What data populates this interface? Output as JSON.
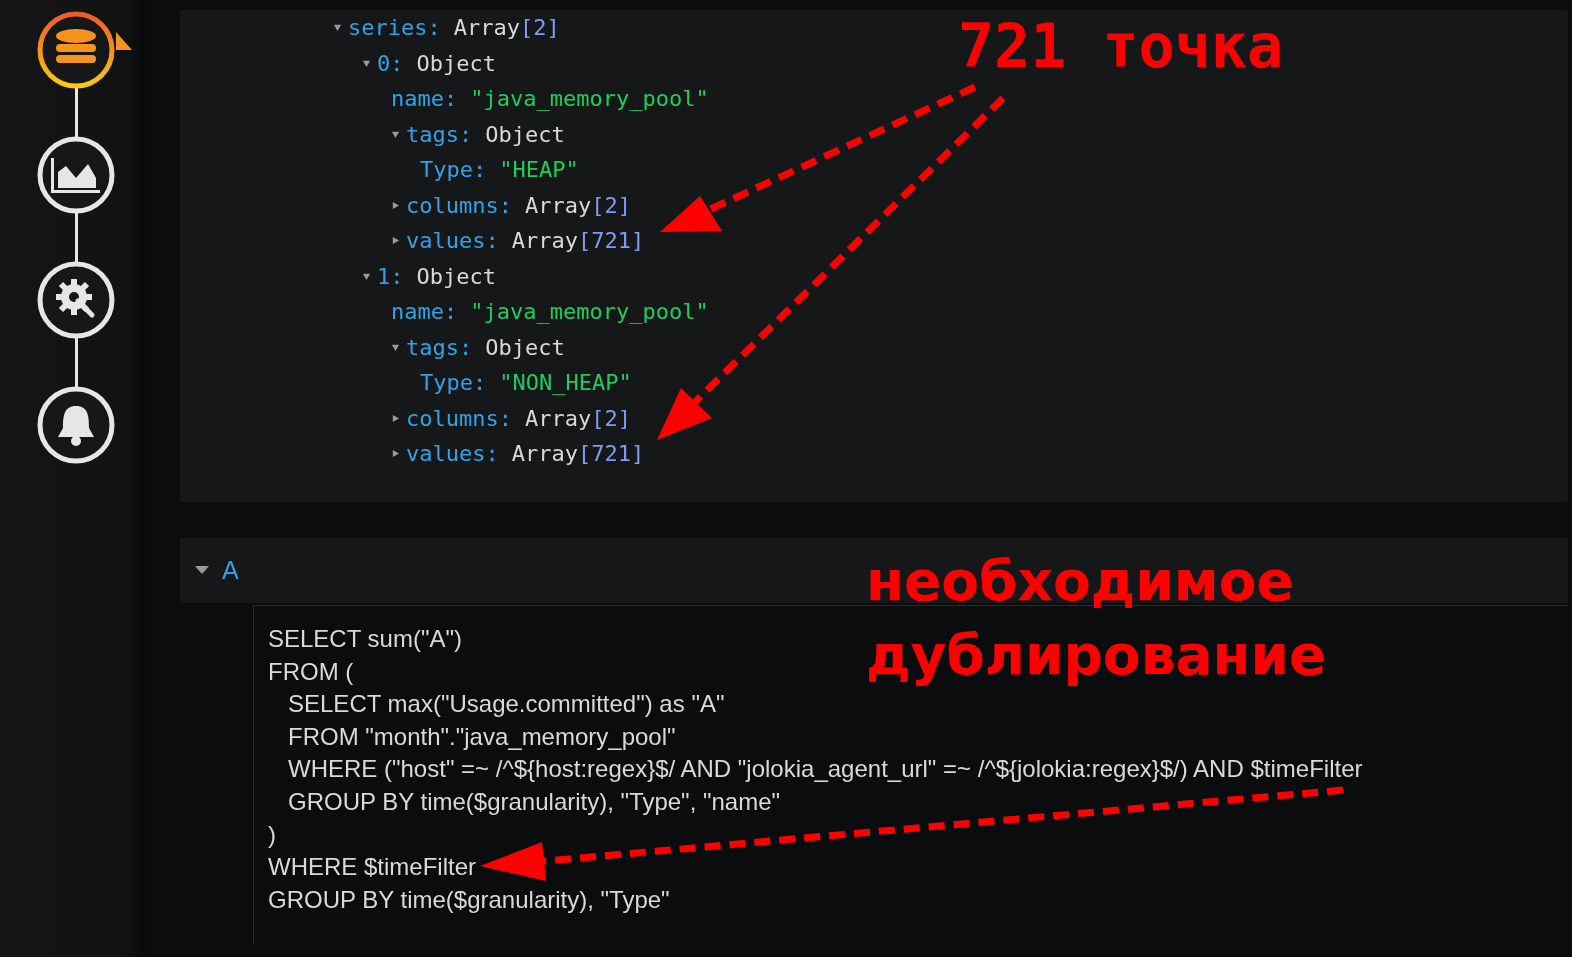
{
  "sidebar": {
    "items": [
      {
        "kind": "database",
        "selected": true
      },
      {
        "kind": "chart",
        "selected": false
      },
      {
        "kind": "settings",
        "selected": false
      },
      {
        "kind": "alert",
        "selected": false
      }
    ]
  },
  "inspector": {
    "tree": [
      {
        "key": "series:",
        "kind": "array",
        "value": "Array",
        "count": "[2]",
        "expanded": true,
        "children": [
          {
            "key": "0:",
            "value": "Object",
            "expanded": true,
            "children": [
              {
                "key": "name:",
                "kind": "string",
                "value": "\"java_memory_pool\""
              },
              {
                "key": "tags:",
                "value": "Object",
                "expanded": true,
                "children": [
                  {
                    "key": "Type:",
                    "kind": "string",
                    "value": "\"HEAP\""
                  }
                ]
              },
              {
                "key": "columns:",
                "kind": "array",
                "value": "Array",
                "count": "[2]",
                "expanded": false
              },
              {
                "key": "values:",
                "kind": "array",
                "value": "Array",
                "count": "[721]",
                "expanded": false
              }
            ]
          },
          {
            "key": "1:",
            "value": "Object",
            "expanded": true,
            "children": [
              {
                "key": "name:",
                "kind": "string",
                "value": "\"java_memory_pool\""
              },
              {
                "key": "tags:",
                "value": "Object",
                "expanded": true,
                "children": [
                  {
                    "key": "Type:",
                    "kind": "string",
                    "value": "\"NON_HEAP\""
                  }
                ]
              },
              {
                "key": "columns:",
                "kind": "array",
                "value": "Array",
                "count": "[2]",
                "expanded": false
              },
              {
                "key": "values:",
                "kind": "array",
                "value": "Array",
                "count": "[721]",
                "expanded": false
              }
            ]
          }
        ]
      }
    ]
  },
  "query": {
    "title": "A",
    "expanded": true,
    "lines": [
      "SELECT sum(\"A\")",
      "FROM (",
      "   SELECT max(\"Usage.committed\") as \"A\"",
      "   FROM \"month\".\"java_memory_pool\"",
      "   WHERE (\"host\" =~ /^${host:regex}$/ AND \"jolokia_agent_url\" =~ /^${jolokia:regex}$/) AND $timeFilter",
      "   GROUP BY time($granularity), \"Type\", \"name\"",
      ")",
      "WHERE $timeFilter",
      "GROUP BY time($granularity), \"Type\""
    ]
  },
  "annotations": [
    {
      "kind": "points",
      "lines": [
        "721 точка"
      ]
    },
    {
      "kind": "duplication",
      "lines": [
        "необходимое",
        "дублирование"
      ]
    }
  ]
}
